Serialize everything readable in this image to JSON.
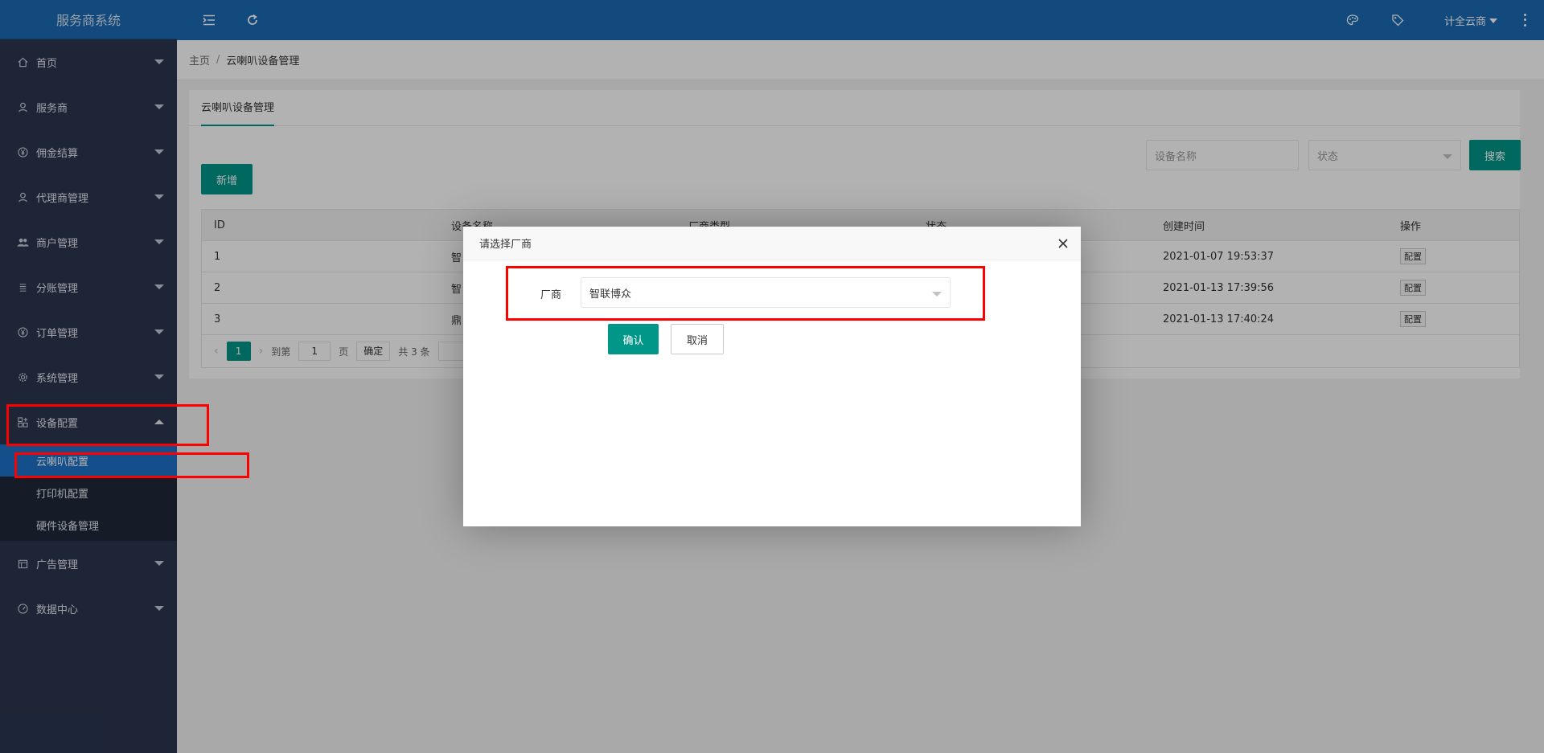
{
  "app": {
    "title": "服务商系统"
  },
  "header": {
    "user_name": "计全云商"
  },
  "sidebar": {
    "items": [
      {
        "label": "首页",
        "icon": "home-icon"
      },
      {
        "label": "服务商",
        "icon": "user-icon"
      },
      {
        "label": "佣金结算",
        "icon": "yen-circle-icon"
      },
      {
        "label": "代理商管理",
        "icon": "user-icon"
      },
      {
        "label": "商户管理",
        "icon": "users-icon"
      },
      {
        "label": "分账管理",
        "icon": "list-icon"
      },
      {
        "label": "订单管理",
        "icon": "yen-circle-icon"
      },
      {
        "label": "系统管理",
        "icon": "gear-icon"
      },
      {
        "label": "设备配置",
        "icon": "grid-icon",
        "expanded": true
      },
      {
        "label": "广告管理",
        "icon": "calendar-icon"
      },
      {
        "label": "数据中心",
        "icon": "gauge-icon"
      }
    ],
    "submenu": [
      {
        "label": "云喇叭配置",
        "active": true
      },
      {
        "label": "打印机配置"
      },
      {
        "label": "硬件设备管理"
      }
    ]
  },
  "breadcrumb": {
    "home": "主页",
    "separator": "/",
    "current": "云喇叭设备管理"
  },
  "tab": {
    "label": "云喇叭设备管理"
  },
  "filters": {
    "name_placeholder": "设备名称",
    "status_placeholder": "状态",
    "search_label": "搜索"
  },
  "toolbar": {
    "add_label": "新增"
  },
  "table": {
    "headers": [
      "ID",
      "设备名称",
      "厂商类型",
      "状态",
      "创建时间",
      "操作"
    ],
    "rows": [
      {
        "id": "1",
        "name": "智",
        "created": "2021-01-07 19:53:37",
        "action": "配置"
      },
      {
        "id": "2",
        "name": "智",
        "created": "2021-01-13 17:39:56",
        "action": "配置"
      },
      {
        "id": "3",
        "name": "鼎",
        "created": "2021-01-13 17:40:24",
        "action": "配置"
      }
    ]
  },
  "pagination": {
    "current": "1",
    "goto_prefix": "到第",
    "goto_value": "1",
    "goto_suffix": "页",
    "ok_label": "确定",
    "total": "共 3 条"
  },
  "modal": {
    "title": "请选择厂商",
    "field_label": "厂商",
    "field_value": "智联博众",
    "confirm_label": "确认",
    "cancel_label": "取消"
  },
  "colors": {
    "primary": "#1a6bb5",
    "sidebar_bg": "#2a3550",
    "accent": "#009688",
    "highlight": "#ff0000"
  }
}
